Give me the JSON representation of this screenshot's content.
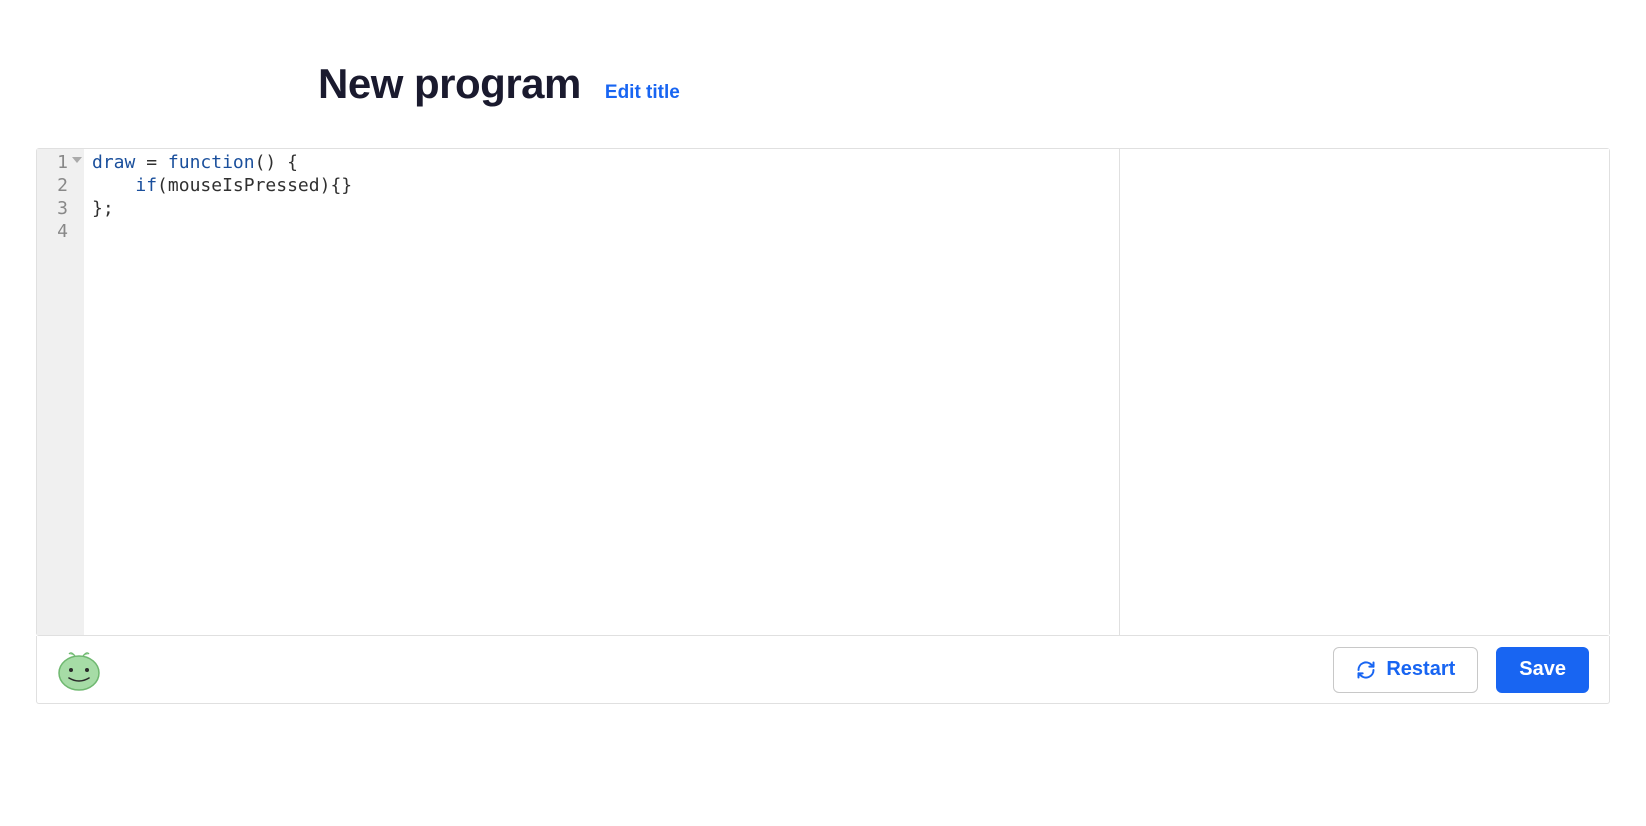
{
  "header": {
    "title": "New program",
    "edit_link": "Edit title"
  },
  "editor": {
    "lines": [
      {
        "num": "1",
        "foldable": true,
        "tokens": [
          {
            "t": "ident",
            "v": "draw"
          },
          {
            "t": "plain",
            "v": " "
          },
          {
            "t": "op",
            "v": "="
          },
          {
            "t": "plain",
            "v": " "
          },
          {
            "t": "keyword",
            "v": "function"
          },
          {
            "t": "paren",
            "v": "()"
          },
          {
            "t": "plain",
            "v": " "
          },
          {
            "t": "paren",
            "v": "{"
          }
        ]
      },
      {
        "num": "2",
        "foldable": false,
        "tokens": [
          {
            "t": "plain",
            "v": "    "
          },
          {
            "t": "keyword",
            "v": "if"
          },
          {
            "t": "paren",
            "v": "("
          },
          {
            "t": "var",
            "v": "mouseIsPressed"
          },
          {
            "t": "paren",
            "v": ")"
          },
          {
            "t": "paren",
            "v": "{}"
          }
        ]
      },
      {
        "num": "3",
        "foldable": false,
        "tokens": [
          {
            "t": "paren",
            "v": "}"
          },
          {
            "t": "op",
            "v": ";"
          }
        ]
      },
      {
        "num": "4",
        "foldable": false,
        "tokens": []
      }
    ]
  },
  "toolbar": {
    "restart_label": "Restart",
    "save_label": "Save"
  },
  "colors": {
    "accent": "#1865f2",
    "title": "#1a1a2e"
  }
}
